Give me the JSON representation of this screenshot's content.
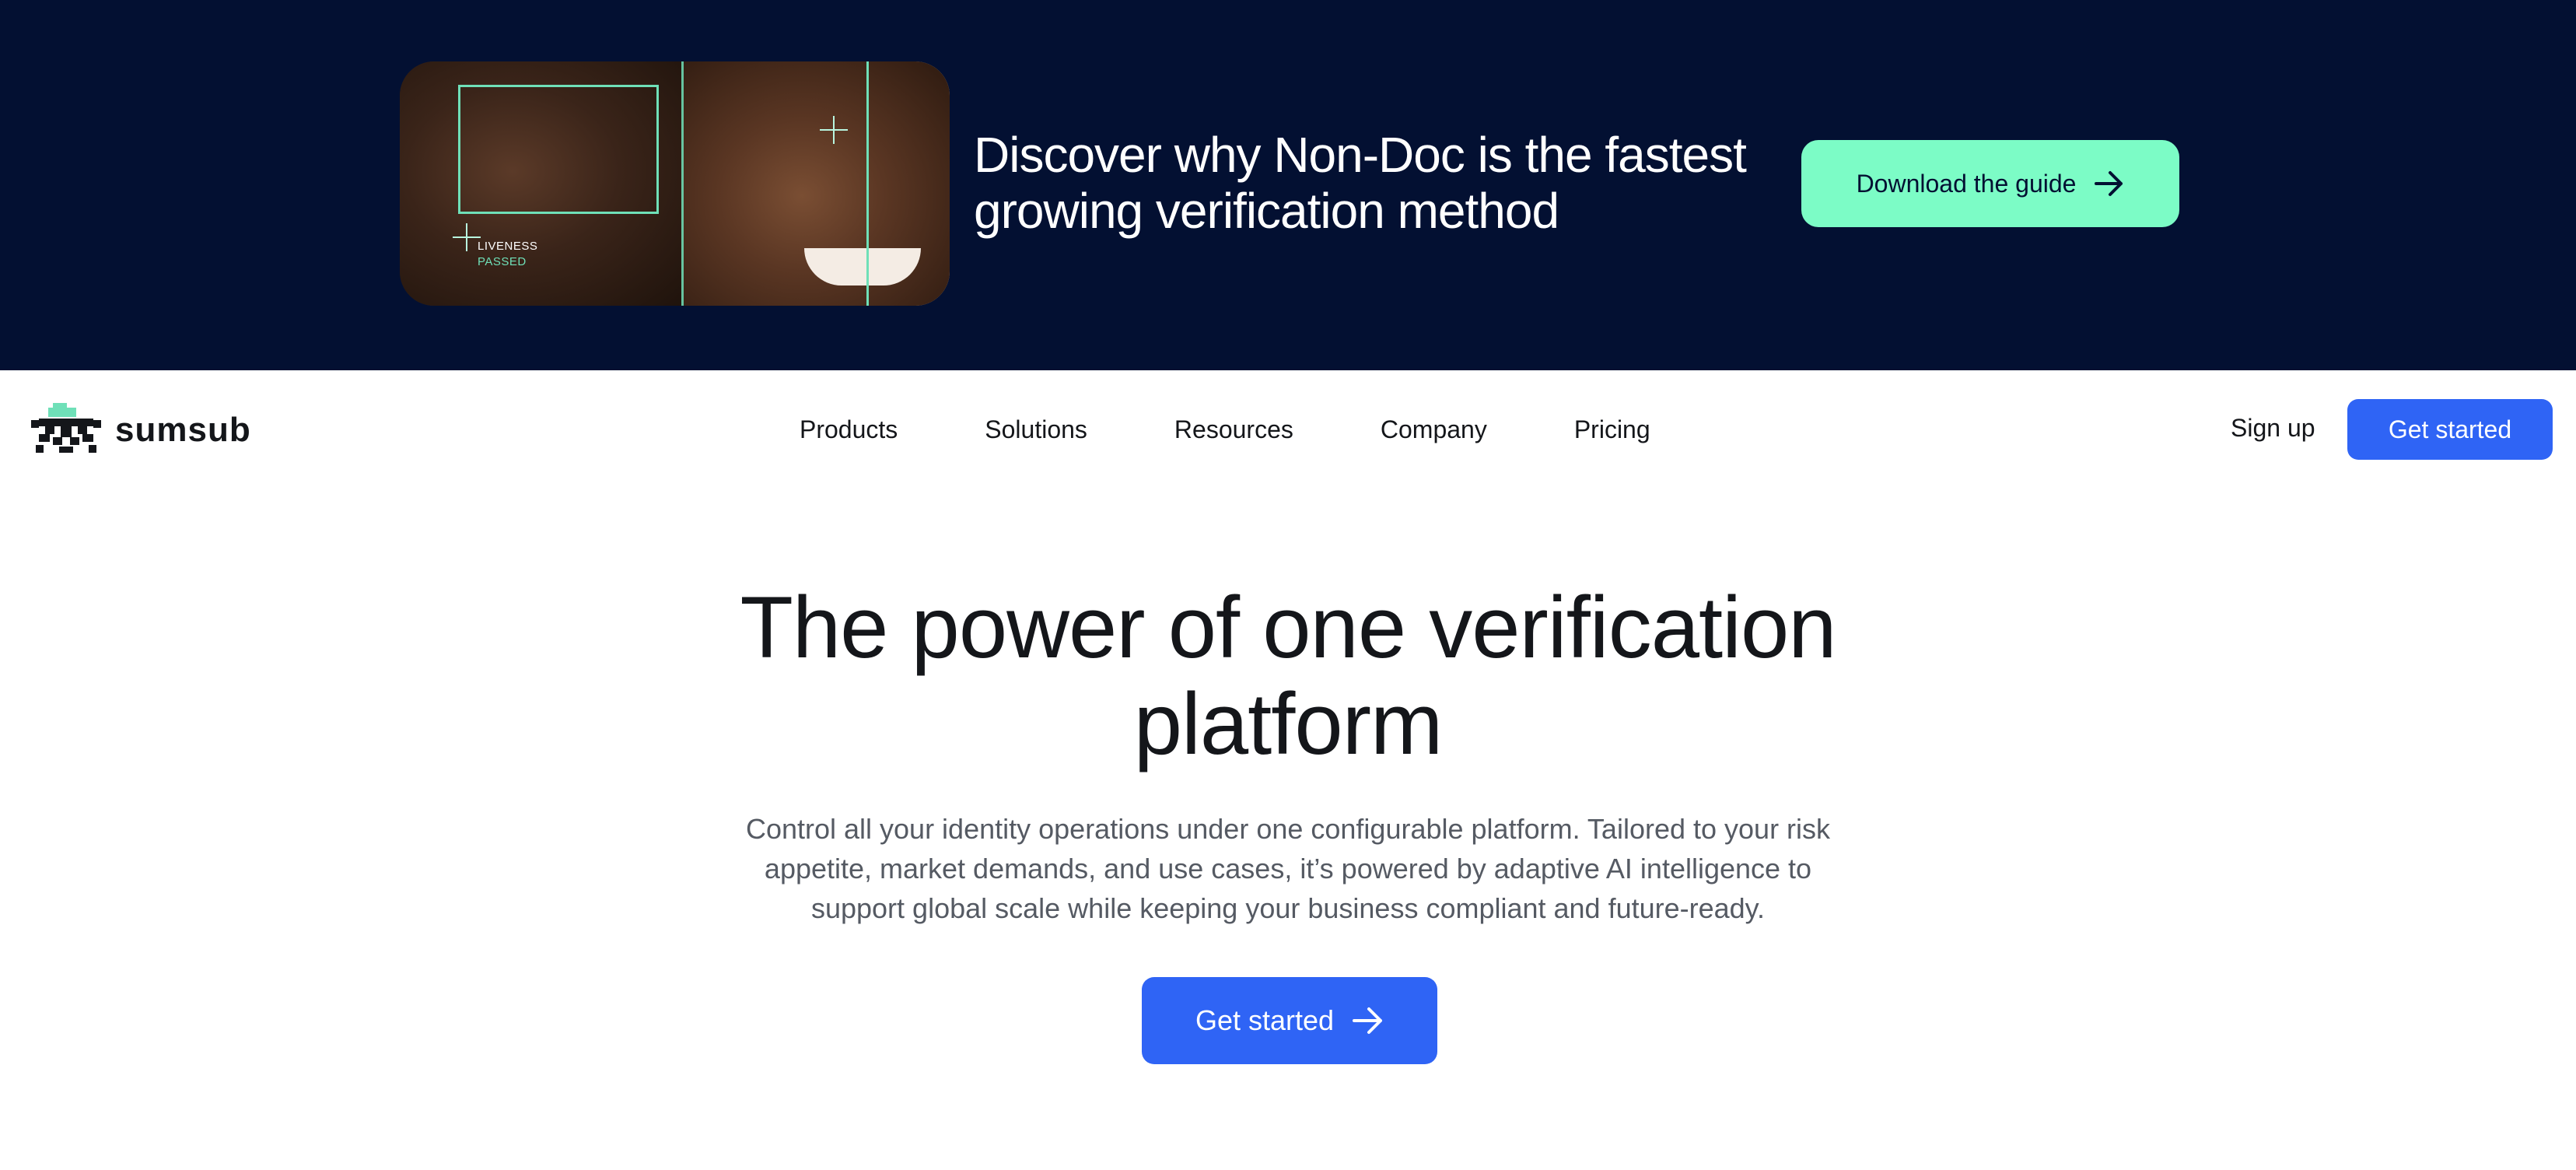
{
  "banner": {
    "image_labels": {
      "line1": "LIVENESS",
      "line2": "PASSED"
    },
    "title_line1": "Discover why Non-Doc is the fastest",
    "title_line2": "growing verification method",
    "cta_label": "Download the guide",
    "cta_icon": "arrow-right-icon",
    "colors": {
      "background": "#031032",
      "cta": "#7cfcc6",
      "accent": "#6fe0b8"
    }
  },
  "navbar": {
    "logo_text": "sumsub",
    "items": [
      {
        "label": "Products"
      },
      {
        "label": "Solutions"
      },
      {
        "label": "Resources"
      },
      {
        "label": "Company"
      },
      {
        "label": "Pricing"
      }
    ],
    "signup_label": "Sign up",
    "cta_label": "Get started",
    "colors": {
      "cta": "#2f64f5"
    }
  },
  "hero": {
    "title_line1": "The power of one verification",
    "title_line2": "platform",
    "subtitle_line1": "Control all your identity operations under one configurable platform. Tailored to your risk",
    "subtitle_line2": "appetite, market demands, and use cases, it’s powered by adaptive AI intelligence to",
    "subtitle_line3": "support global scale while keeping your business compliant and future-ready.",
    "cta_label": "Get started",
    "cta_icon": "arrow-right-icon"
  }
}
